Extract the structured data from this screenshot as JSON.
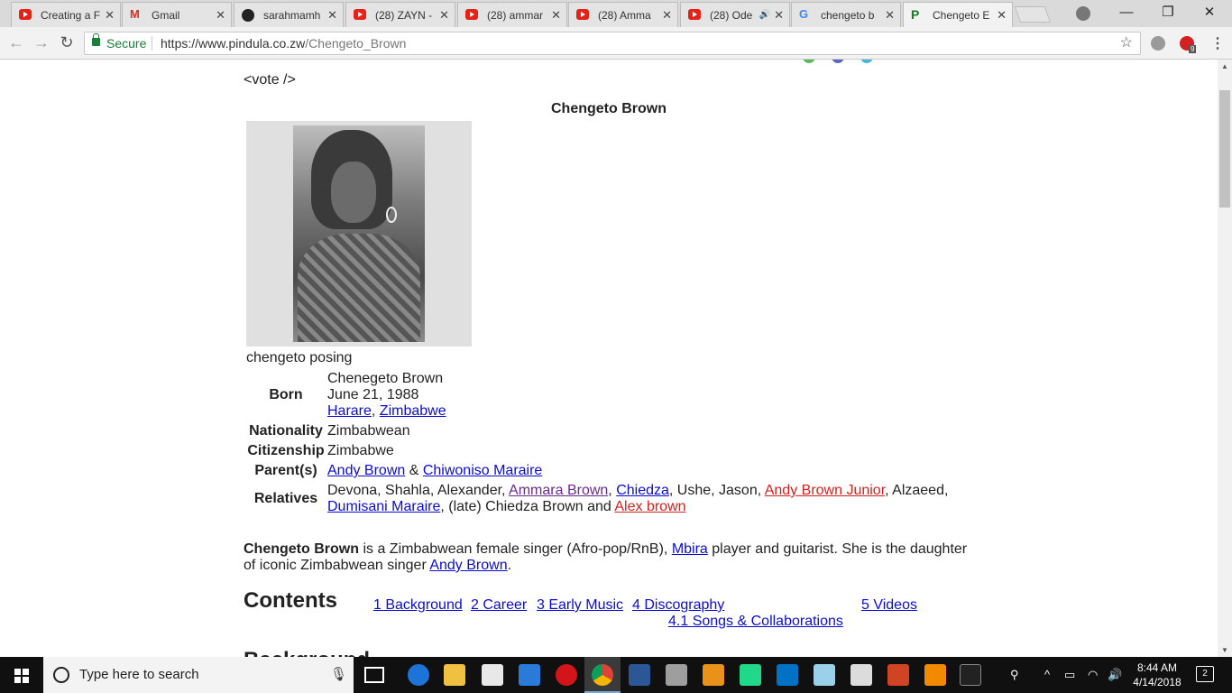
{
  "browser": {
    "tabs": [
      {
        "label": "Creating a F",
        "icon": "youtube-icon"
      },
      {
        "label": "Gmail",
        "icon": "gmail-icon"
      },
      {
        "label": "sarahmamh",
        "icon": "github-icon"
      },
      {
        "label": "(28) ZAYN -",
        "icon": "youtube-icon"
      },
      {
        "label": "(28) ammar",
        "icon": "youtube-icon"
      },
      {
        "label": "(28) Amma",
        "icon": "youtube-icon"
      },
      {
        "label": "(28) Ode",
        "icon": "youtube-icon",
        "audio": "🔊"
      },
      {
        "label": "chengeto b",
        "icon": "google-icon"
      },
      {
        "label": "Chengeto E",
        "icon": "pindula-icon",
        "active": true
      }
    ],
    "tab_close": "✕",
    "window": {
      "minimize": "—",
      "restore": "❐",
      "close": "✕"
    },
    "toolbar": {
      "back": "←",
      "forward": "→",
      "reload": "↻",
      "secure_label": "Secure",
      "url_base": "https://www.pindula.co.zw",
      "url_path": "/Chengeto_Brown",
      "star": "☆",
      "menu": "⋮",
      "badge": "9"
    }
  },
  "page": {
    "vote": "<vote />",
    "infobox": {
      "title": "Chengeto Brown",
      "caption": "chengeto posing",
      "born_label": "Born",
      "born_name": "Chenegeto Brown",
      "born_date": "June 21, 1988",
      "born_city": "Harare",
      "born_comma": ", ",
      "born_country": "Zimbabwe",
      "nationality_label": "Nationality",
      "nationality": "Zimbabwean",
      "citizenship_label": "Citizenship",
      "citizenship": "Zimbabwe",
      "parents_label": "Parent(s)",
      "parent1": "Andy Brown",
      "parents_and": " & ",
      "parent2": "Chiwoniso Maraire",
      "relatives_label": "Relatives",
      "rel_1": "Devona, Shahla, Alexander, ",
      "rel_ammara": "Ammara Brown",
      "rel_comma1": ", ",
      "rel_chiedza": "Chiedza",
      "rel_2": ", Ushe, Jason, ",
      "rel_andy_jr": "Andy Brown Junior",
      "rel_3": ", Alzaeed,",
      "rel_dumisani": "Dumisani Maraire",
      "rel_4": ", (late) Chiedza Brown and ",
      "rel_alex": "Alex brown"
    },
    "intro": {
      "name": "Chengeto Brown",
      "t1": " is a Zimbabwean female singer (Afro-pop/RnB), ",
      "mbira": "Mbira",
      "t2": " player and guitarist. She is the daughter of iconic Zimbabwean singer ",
      "andy": "Andy Brown",
      "t3": "."
    },
    "contents_title": "Contents",
    "toc": [
      "1 Background",
      "2 Career",
      "3 Early Music",
      "4 Discography",
      "4.1 Songs & Collaborations",
      "5 Videos"
    ],
    "next_heading": "Background"
  },
  "taskbar": {
    "search_placeholder": "Type here to search",
    "mic": "🎙",
    "time": "8:44 AM",
    "date": "4/14/2018",
    "notifications": "2",
    "tray_up": "^",
    "tray_person": "⚲",
    "tray_battery": "▭",
    "tray_wifi": "◠",
    "tray_volume": "🔊"
  },
  "colors": {
    "link": "#0b0bd6",
    "visited_link": "#6b2b8f",
    "new_link": "#d72020",
    "secure_green": "#188038",
    "taskbar": "#101010"
  }
}
